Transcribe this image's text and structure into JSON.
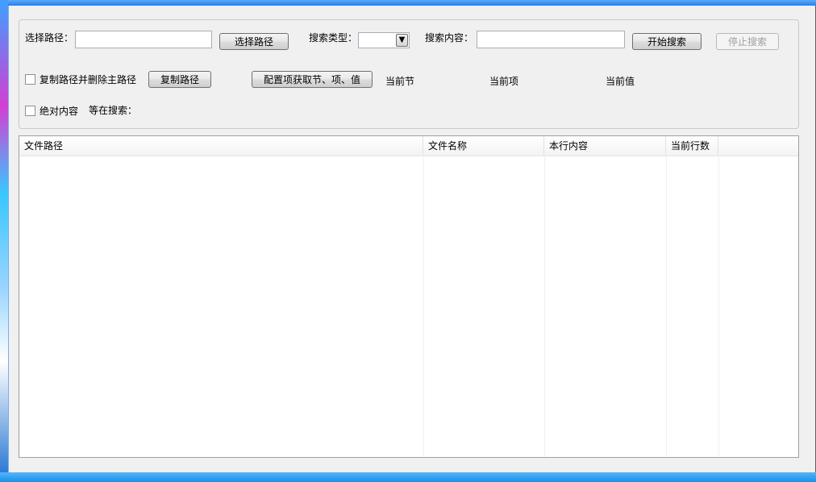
{
  "toolbar": {
    "path_label": "选择路径：",
    "path_value": "",
    "choose_path_button": "选择路径",
    "search_type_label": "搜索类型：",
    "search_type_value": "",
    "search_content_label": "搜索内容：",
    "search_content_value": "",
    "start_search_button": "开始搜索",
    "stop_search_button": "停止搜索"
  },
  "options": {
    "copy_delete_label": "复制路径并删除主路径",
    "copy_path_button": "复制路径",
    "config_button": "配置项获取节、项、值",
    "current_section": "当前节",
    "current_item": "当前项",
    "current_value": "当前值",
    "absolute_label": "绝对内容",
    "waiting_label": "等在搜索："
  },
  "table": {
    "columns": [
      "文件路径",
      "文件名称",
      "本行内容",
      "当前行数"
    ]
  }
}
